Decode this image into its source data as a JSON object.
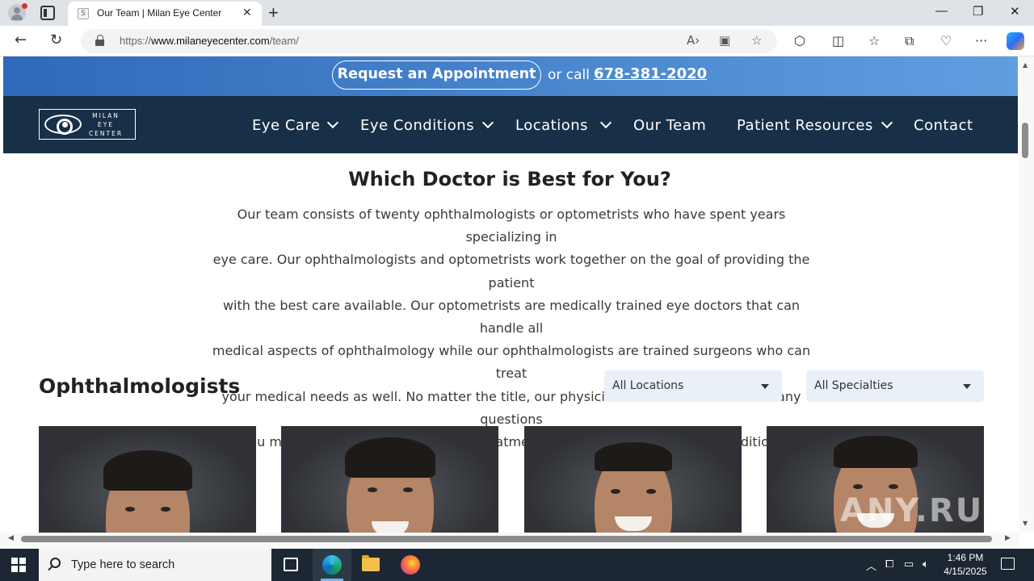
{
  "browser": {
    "tab_title": "Our Team | Milan Eye Center",
    "url_prefix": "https://",
    "url_domain": "www.milaneyecenter.com",
    "url_path": "/team/"
  },
  "topbar": {
    "appointment_label": "Request an Appointment",
    "or_call": "or call",
    "phone": "678-381-2020"
  },
  "logo": {
    "line1": "MILAN",
    "line2": "EYE",
    "line3": "CENTER"
  },
  "nav": {
    "items": [
      {
        "label": "Eye Care",
        "has_dropdown": true
      },
      {
        "label": "Eye Conditions",
        "has_dropdown": true
      },
      {
        "label": "Locations",
        "has_dropdown": true
      },
      {
        "label": "Our Team",
        "has_dropdown": false
      },
      {
        "label": "Patient Resources",
        "has_dropdown": true
      },
      {
        "label": "Contact",
        "has_dropdown": false
      }
    ]
  },
  "main": {
    "heading": "Which Doctor is Best for You?",
    "intro_lines": [
      "Our team consists of twenty ophthalmologists or optometrists who have spent years specializing in",
      "eye care. Our ophthalmologists and optometrists work together on the goal of providing the patient",
      "with the best care available. Our optometrists are medically trained eye doctors that can handle all",
      "medical aspects of ophthalmology while our ophthalmologists are trained surgeons who can treat",
      "your medical needs as well. No matter the title, our physicians will be able to answer any questions",
      "you may have and ensure that your treatment is tailored to your specific condition."
    ],
    "section_title": "Ophthalmologists",
    "filter_location": "All Locations",
    "filter_specialty": "All Specialties"
  },
  "watermark": "ANY.RUN",
  "taskbar": {
    "search_placeholder": "Type here to search",
    "time": "1:46 PM",
    "date": "4/15/2025"
  },
  "colors": {
    "topbar_start": "#2f69b9",
    "topbar_end": "#5f9fe0",
    "nav_bg": "#183047",
    "filter_bg": "#eaf0f7"
  }
}
